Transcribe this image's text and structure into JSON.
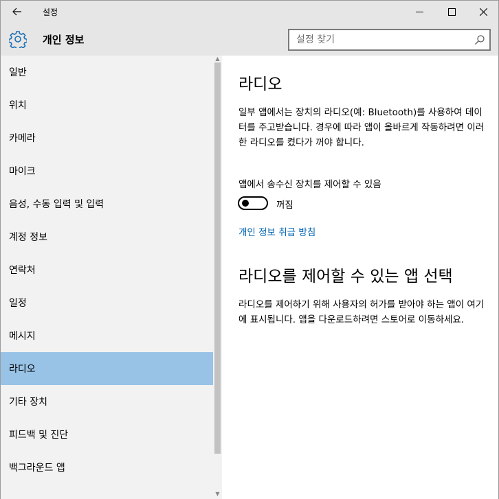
{
  "window": {
    "title": "설정",
    "back_icon": "back-arrow-icon",
    "controls": [
      "minimize-icon",
      "maximize-icon",
      "close-icon"
    ]
  },
  "header": {
    "icon": "gear-icon",
    "title": "개인 정보",
    "search": {
      "placeholder": "설정 찾기",
      "value": ""
    }
  },
  "sidebar": {
    "items": [
      {
        "label": "일반",
        "selected": false
      },
      {
        "label": "위치",
        "selected": false
      },
      {
        "label": "카메라",
        "selected": false
      },
      {
        "label": "마이크",
        "selected": false
      },
      {
        "label": "음성, 수동 입력 및 입력",
        "selected": false
      },
      {
        "label": "계정 정보",
        "selected": false
      },
      {
        "label": "연락처",
        "selected": false
      },
      {
        "label": "일정",
        "selected": false
      },
      {
        "label": "메시지",
        "selected": false
      },
      {
        "label": "라디오",
        "selected": true
      },
      {
        "label": "기타 장치",
        "selected": false
      },
      {
        "label": "피드백 및 진단",
        "selected": false
      },
      {
        "label": "백그라운드 앱",
        "selected": false
      }
    ]
  },
  "main": {
    "heading": "라디오",
    "description": "일부 앱에서는 장치의 라디오(예: Bluetooth)를 사용하여 데이터를 주고받습니다. 경우에 따라 앱이 올바르게 작동하려면 이러한 라디오를 켰다가 꺼야 합니다.",
    "toggle": {
      "label": "앱에서 송수신 장치를 제어할 수 있음",
      "state": "꺼짐",
      "on": false
    },
    "privacy_link": "개인 정보 취급 방침",
    "section2": {
      "heading": "라디오를 제어할 수 있는 앱 선택",
      "description": "라디오를 제어하기 위해 사용자의 허가를 받아야 하는 앱이 여기에 표시됩니다. 앱을 다운로드하려면 스토어로 이동하세요."
    }
  },
  "colors": {
    "chrome": "#e6e6e6",
    "sidebar": "#f2f2f2",
    "selected": "#99c3e6",
    "link": "#0063b1"
  }
}
